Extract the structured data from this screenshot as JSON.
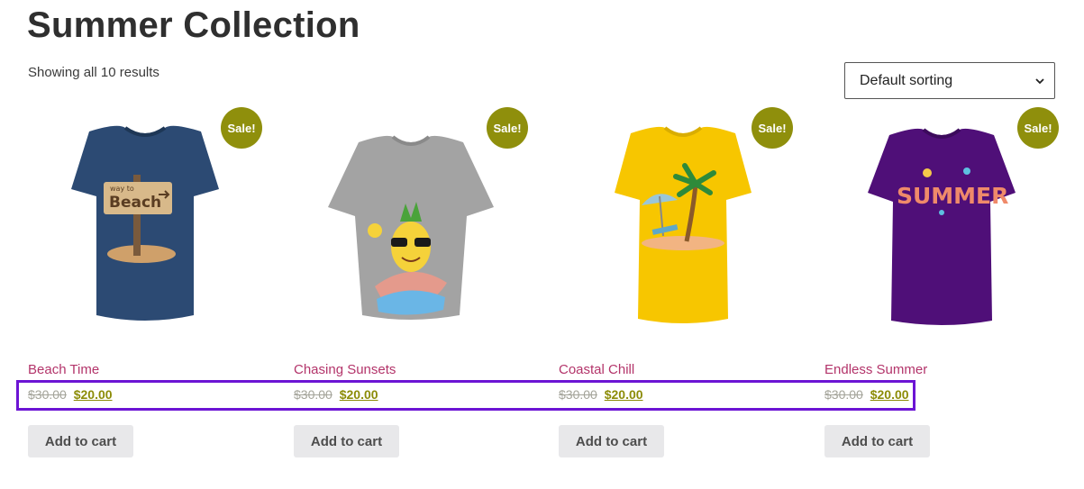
{
  "page": {
    "title": "Summer Collection",
    "result_count": "Showing all 10 results"
  },
  "sorting": {
    "selected": "Default sorting"
  },
  "products": [
    {
      "name": "Beach Time",
      "regular_price": "$30.00",
      "sale_price": "$20.00",
      "badge": "Sale!",
      "button": "Add to cart",
      "shirt_color": "#2c4a73",
      "print_text": "Beach",
      "print_small": "way to"
    },
    {
      "name": "Chasing Sunsets",
      "regular_price": "$30.00",
      "sale_price": "$20.00",
      "badge": "Sale!",
      "button": "Add to cart",
      "shirt_color": "#a3a3a3"
    },
    {
      "name": "Coastal Chill",
      "regular_price": "$30.00",
      "sale_price": "$20.00",
      "badge": "Sale!",
      "button": "Add to cart",
      "shirt_color": "#f7c600"
    },
    {
      "name": "Endless Summer",
      "regular_price": "$30.00",
      "sale_price": "$20.00",
      "badge": "Sale!",
      "button": "Add to cart",
      "shirt_color": "#4f0f78",
      "print_text": "SUMMER"
    }
  ],
  "colors": {
    "sale_badge": "#8f8f0c",
    "title_link": "#b3346a",
    "price": "#8c8c08",
    "highlight": "#6c14d4"
  }
}
